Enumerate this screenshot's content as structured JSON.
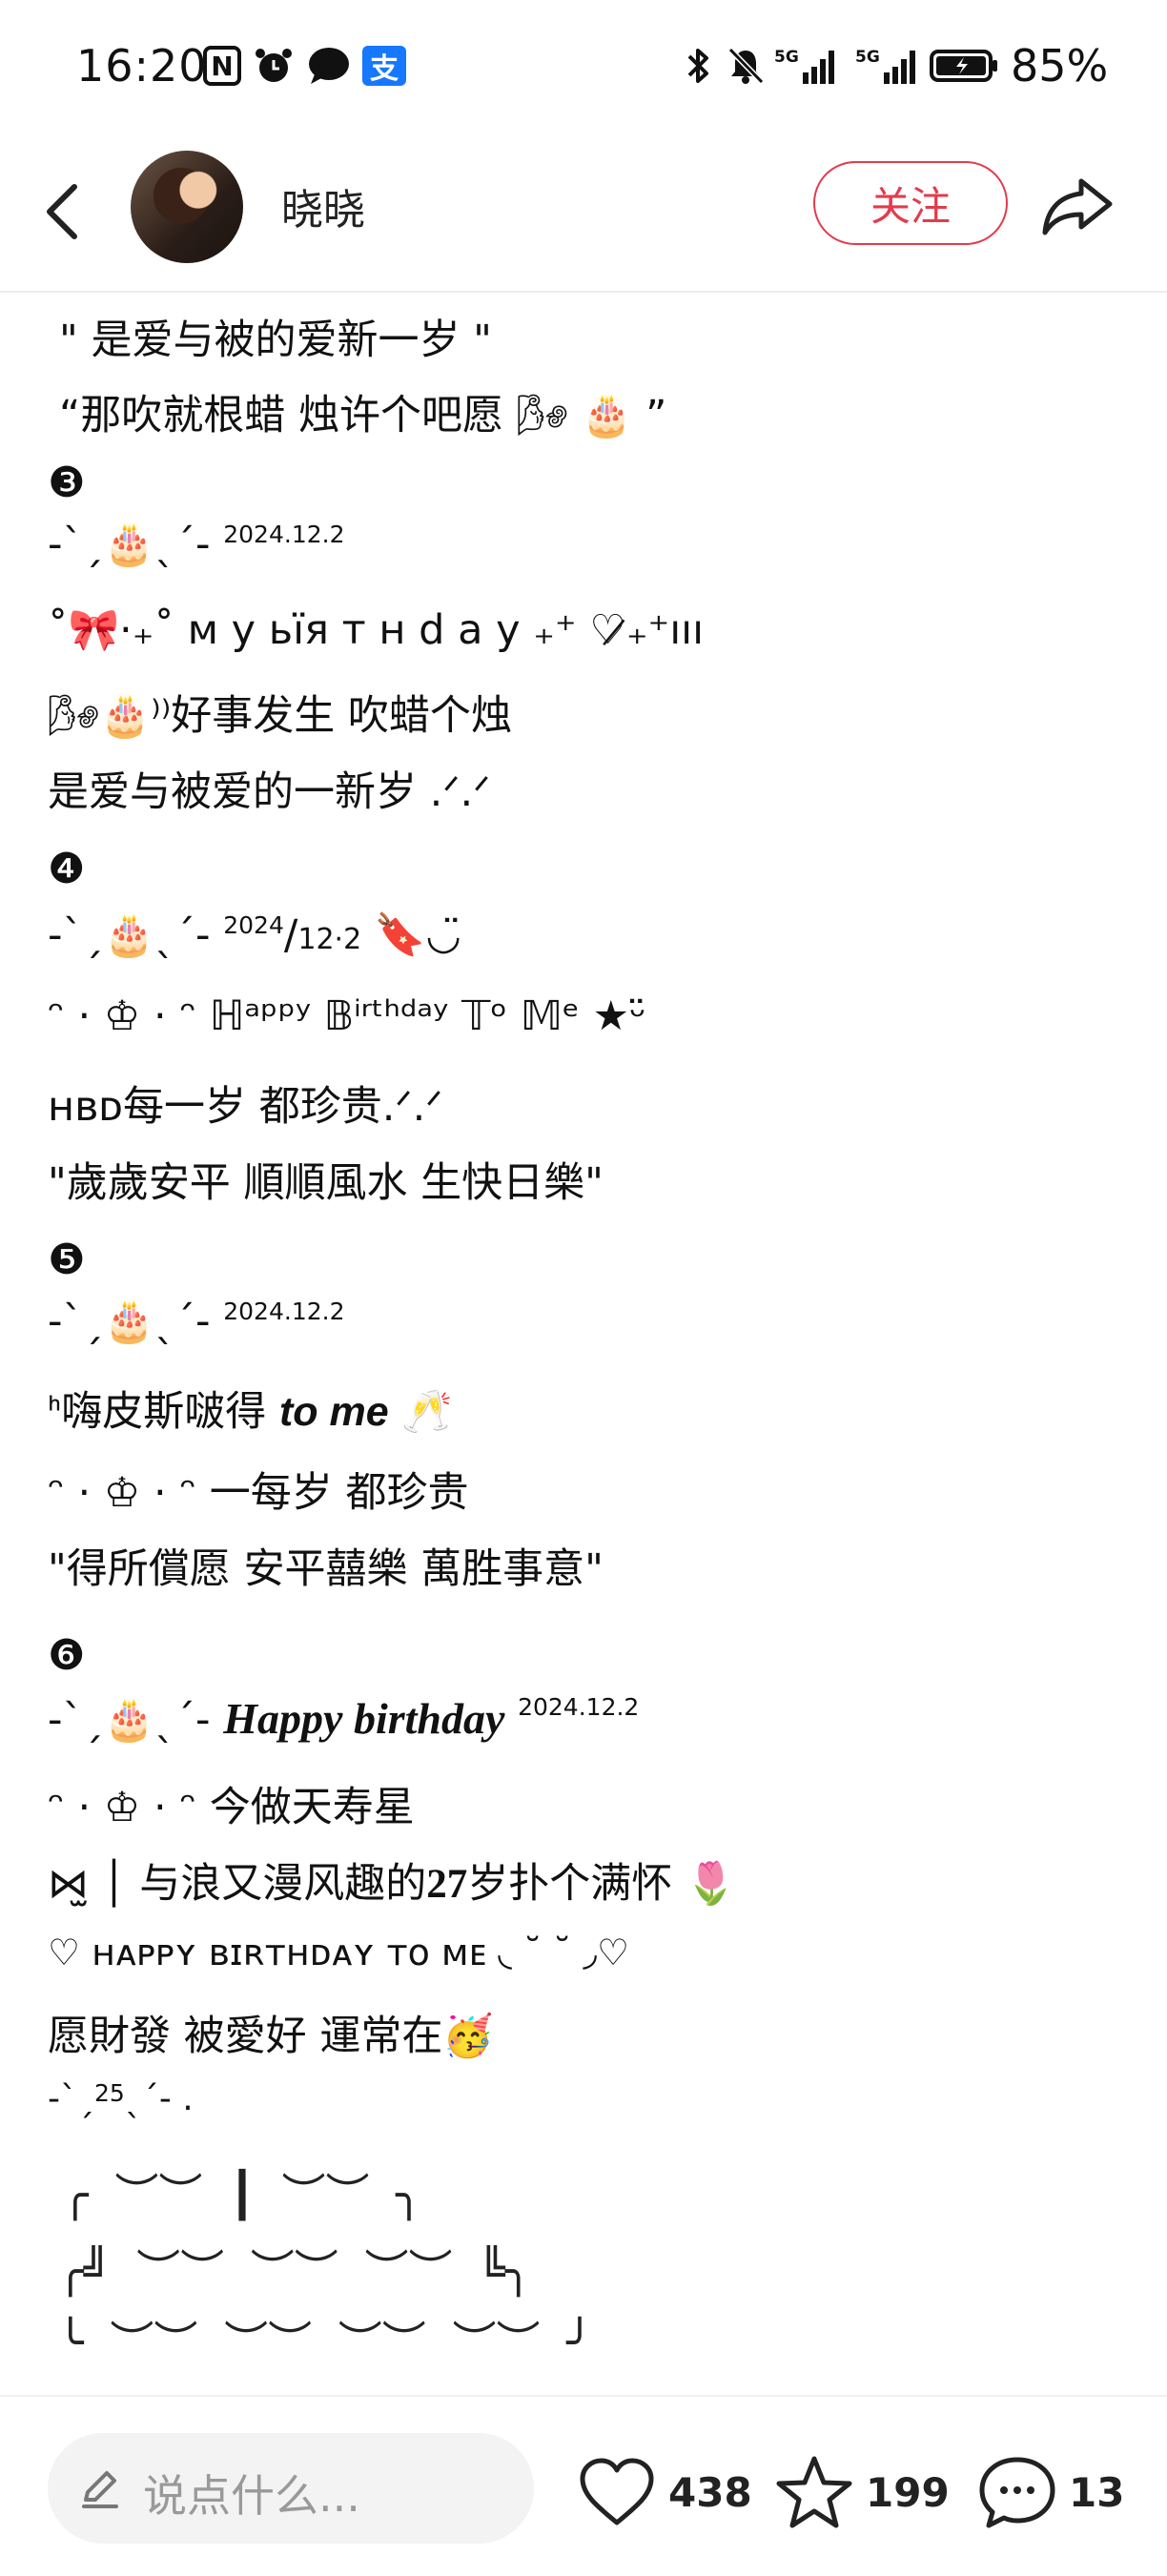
{
  "status_bar": {
    "time": "16:20",
    "n_label": "N",
    "pay_label": "支",
    "sig1": "5G",
    "sig2": "5G",
    "battery": "85%"
  },
  "header": {
    "username": "晓晓",
    "follow_label": "关注"
  },
  "content": {
    "l01": "\" 是爱与被的爱新一岁 \"",
    "l02": "“那吹就根蜡 烛许个吧愿 🌬 🎂 ”",
    "n3": "❸",
    "l03a": "-ˋˏ🎂ˎˊ-",
    "l03b": "2024.12.2",
    "l04": "˚🎀·₊˚ м у  ьїя т н d a у ₊⁺ ♡̷₊⁺ııı",
    "l05": "🌬🎂⁾⁾好事发生 吹蜡个烛",
    "l06": "是爱与被爱的一新岁 .ᐟ.ᐟ",
    "n4": "❹",
    "l07a": "-ˋˏ🎂ˎˊ-",
    "l07b": "2024",
    "l07c": "/",
    "l07d": "12·2",
    "l07e": "🔖◡̈",
    "l08": "ᵔ · ♔ · ᵔ ℍᵃᵖᵖʸ 𝔹ⁱʳᵗʰᵈᵃʸ 𝕋ᵒ 𝕄ᵉ ★ᵕ̈",
    "l09": "ʜʙᴅ每一岁 都珍贵.ᐟ.ᐟ",
    "l10": "\"歲歲安平 順順風水 生快日樂\"",
    "n5": "❺",
    "l11a": "-ˋˏ🎂ˎˊ-",
    "l11b": "2024.12.2",
    "l12a": "ᑋ嗨皮斯啵得 ",
    "l12b": "to me",
    "l12c": " 🥂",
    "l13": "ᵔ · ♔ · ᵔ 一每岁 都珍贵",
    "l14": "\"得所償愿 安平囍樂 萬胜事意\"",
    "n6": "❻",
    "l15a": "-ˋˏ🎂ˎˊ-",
    "l15b": "Happy birthday",
    "l15c": "2024.12.2",
    "l16": "ᵔ · ♔ · ᵔ 今做天寿星",
    "l17a": "⋈̫ │ 与浪又漫风趣的",
    "l17b": "27",
    "l17c": "岁扑个满怀 🌷",
    "l18": "♡ ʜᴀᴘᴘʏ ʙɪʀᴛʜᴅᴀʏ ᴛᴏ ᴍᴇ ◟ ˘ ˘ ◞♡",
    "l19": "愿財發 被愛好 運常在🥳",
    "l20a": "-ˋˏ",
    "l20b": "25",
    "l20c": "ˎˊ-  .",
    "cake1": "╭ ︶︶ ┃ ︶︶ ╮",
    "cake2": "╭╝ ︶︶ ︶︶ ︶︶ ╚╮",
    "cake3": "╰ ︶︶ ︶︶ ︶︶ ︶︶ ╯"
  },
  "bottom": {
    "comment_placeholder": "说点什么...",
    "likes": "438",
    "stars": "199",
    "comments": "13"
  },
  "colors": {
    "accent_red": "#e33b4c",
    "alipay_blue": "#1677ff"
  }
}
